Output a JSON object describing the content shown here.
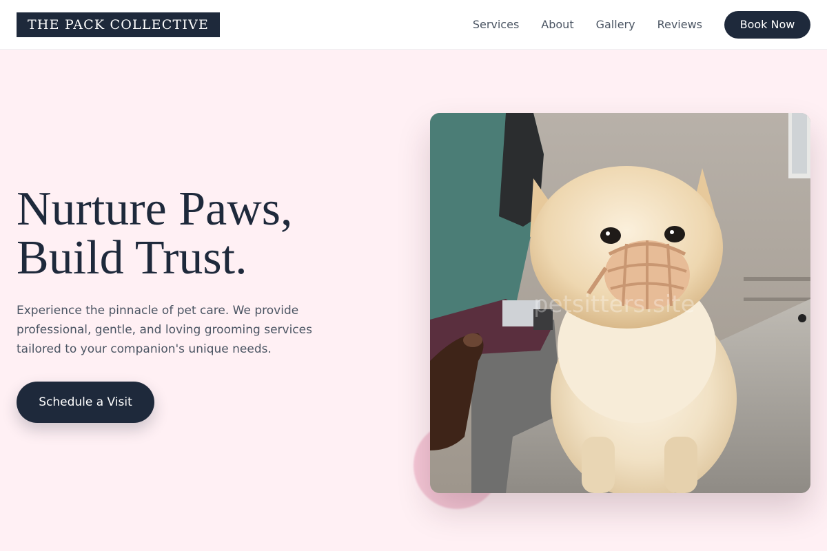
{
  "brand": {
    "logo_text": "THE PACK COLLECTIVE"
  },
  "nav": {
    "links": [
      "Services",
      "About",
      "Gallery",
      "Reviews"
    ],
    "cta_label": "Book Now"
  },
  "hero": {
    "heading_line1": "Nurture Paws,",
    "heading_line2": "Build Trust.",
    "description": "Experience the pinnacle of pet care. We provide professional, gentle, and loving grooming services tailored to your companion's unique needs.",
    "cta_label": "Schedule a Visit",
    "image_watermark": "petsitters.site"
  },
  "colors": {
    "page_background": "#fff0f4",
    "primary": "#1e293b",
    "body_text": "#4b5563",
    "decor_pink": "#f3bfd0"
  }
}
